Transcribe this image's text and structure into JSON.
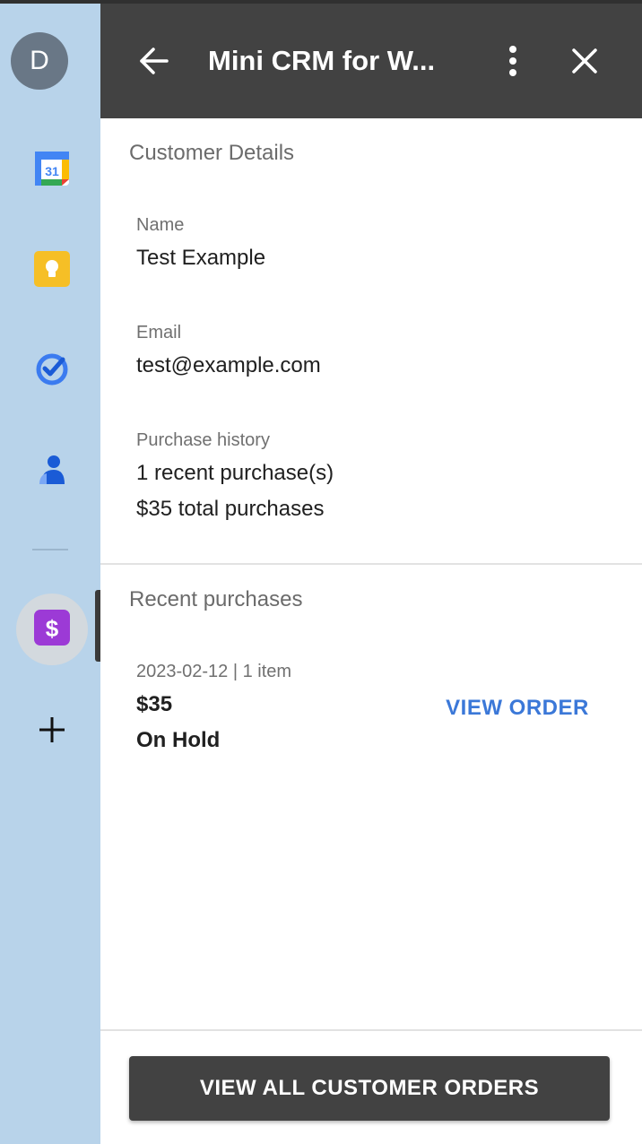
{
  "rail": {
    "avatar_letter": "D",
    "icons": [
      "calendar-icon",
      "keep-icon",
      "tasks-icon",
      "contacts-icon",
      "crm-dollar-icon",
      "add-icon"
    ],
    "calendar_day": "31"
  },
  "header": {
    "title": "Mini CRM for W...",
    "back_icon": "arrow-left-icon",
    "menu_icon": "more-vert-icon",
    "close_icon": "close-icon"
  },
  "details": {
    "section_title": "Customer Details",
    "name_label": "Name",
    "name_value": "Test Example",
    "email_label": "Email",
    "email_value": "test@example.com",
    "history_label": "Purchase history",
    "history_line1": "1 recent purchase(s)",
    "history_line2": "$35 total purchases"
  },
  "recent": {
    "section_title": "Recent purchases",
    "orders": [
      {
        "meta": "2023-02-12 | 1 item",
        "amount": "$35",
        "status": "On Hold",
        "action": "VIEW ORDER"
      }
    ]
  },
  "footer": {
    "button_label": "VIEW ALL CUSTOMER ORDERS"
  },
  "colors": {
    "rail_bg": "#b8d3ea",
    "header_bg": "#424242",
    "link": "#3b78d8",
    "crm_icon": "#9c3ad6"
  }
}
